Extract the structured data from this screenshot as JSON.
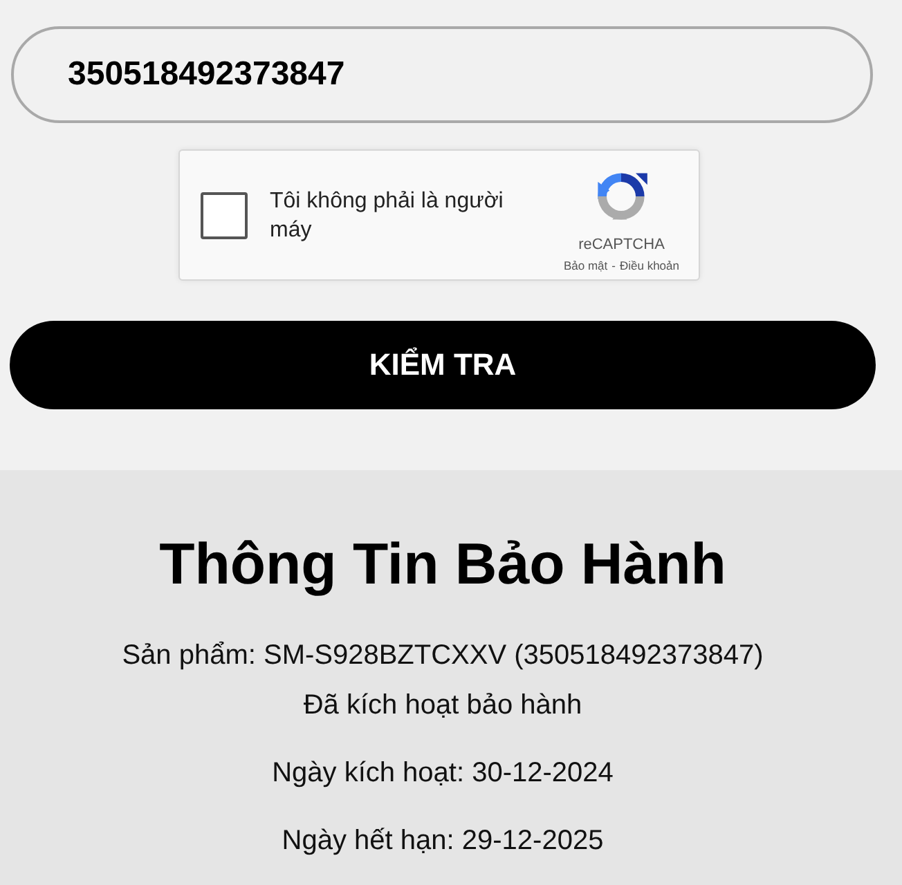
{
  "search": {
    "value": "350518492373847"
  },
  "captcha": {
    "checked": false,
    "label": "Tôi không phải là người máy",
    "brand": "reCAPTCHA",
    "privacy_link": "Bảo mật",
    "separator": "-",
    "terms_link": "Điều khoản"
  },
  "submit_button": {
    "label": "KIỂM TRA"
  },
  "warranty": {
    "title": "Thông Tin Bảo Hành",
    "paragraphs": [
      {
        "lines": [
          "Sản phẩm: SM-S928BZTCXXV (350518492373847)",
          "Đã kích hoạt bảo hành"
        ]
      },
      {
        "lines": [
          "Ngày kích hoạt: 30-12-2024"
        ]
      },
      {
        "lines": [
          "Ngày hết hạn: 29-12-2025"
        ]
      }
    ]
  }
}
